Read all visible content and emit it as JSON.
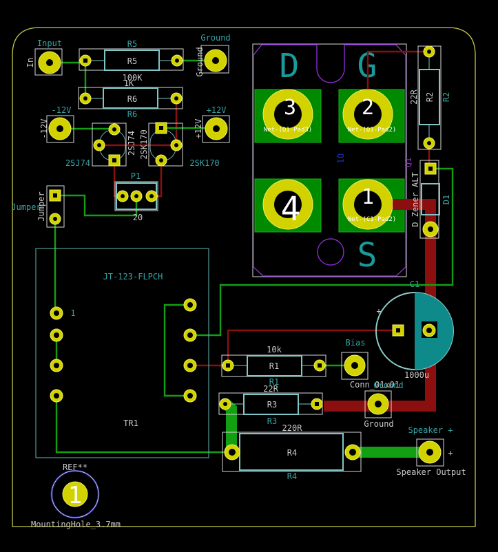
{
  "colors": {
    "background": "#000000",
    "board_edge": "#c8c84a",
    "pad": "#d2d200",
    "front_copper": "#8c0f0f",
    "back_copper": "#12a012",
    "silkscreen": "#35a5a5",
    "fab": "#7fc6c6"
  },
  "input": {
    "label": "Input",
    "value": "In",
    "pad": "1"
  },
  "r5": {
    "ref": "R5",
    "ref_inner": "R5",
    "value": "100K"
  },
  "ground_top": {
    "label": "Ground",
    "value": "Ground",
    "pad": "1"
  },
  "r6": {
    "ref": "R6",
    "ref_inner": "R6",
    "value": "1K"
  },
  "neg12": {
    "label": "-12V",
    "value": "-12V",
    "pad": "1"
  },
  "pos12": {
    "label": "+12V",
    "value": "+12V",
    "pad": "1"
  },
  "q_2sj74": {
    "ref": "2SJ74",
    "value": "2SJ74",
    "inner": "2SJ74"
  },
  "q_2sk170": {
    "ref": "2SK170",
    "value": "2SK170",
    "inner": "2SK170"
  },
  "p1": {
    "ref": "P1",
    "value": "20"
  },
  "jumper": {
    "label": "Jumper",
    "value": "Jumper"
  },
  "tr1": {
    "value": "JT-123-FLPCH",
    "ref": "TR1",
    "pin1": "1"
  },
  "mounting": {
    "ref": "REF**",
    "value": "MountingHole_3.7mm",
    "pad": "1"
  },
  "q1": {
    "ref": "Q1",
    "pads": [
      "3",
      "2",
      "4",
      "1"
    ],
    "pin_letters": {
      "drain": "D",
      "gate": "G",
      "source": "S"
    },
    "nets": [
      "Net-(Q1-Pad3)",
      "Net-(Q1-Pad2)",
      "Net-(C1-Pad2)"
    ]
  },
  "r2": {
    "ref": "R2",
    "ref_inner": "R2",
    "value": "22R"
  },
  "d1": {
    "ref": "D1",
    "value": "D_Zener_ALT",
    "q1_ref": "Q1"
  },
  "c1": {
    "ref": "C1",
    "value": "1000u",
    "plus": "+"
  },
  "r1": {
    "ref": "R1",
    "ref_inner": "R1",
    "value": "10k"
  },
  "bias": {
    "label": "Bias",
    "value": "Conn_01x01",
    "pad": "1"
  },
  "r3": {
    "ref": "R3",
    "ref_inner": "R3",
    "value": "22R"
  },
  "ground_mid": {
    "label": "Ground",
    "value": "Ground",
    "pad": "1"
  },
  "r4": {
    "ref": "R4",
    "ref_inner": "R4",
    "value": "220R"
  },
  "speaker": {
    "label": "Speaker +",
    "value": "Speaker Output",
    "plus": "+",
    "pad": "1"
  }
}
